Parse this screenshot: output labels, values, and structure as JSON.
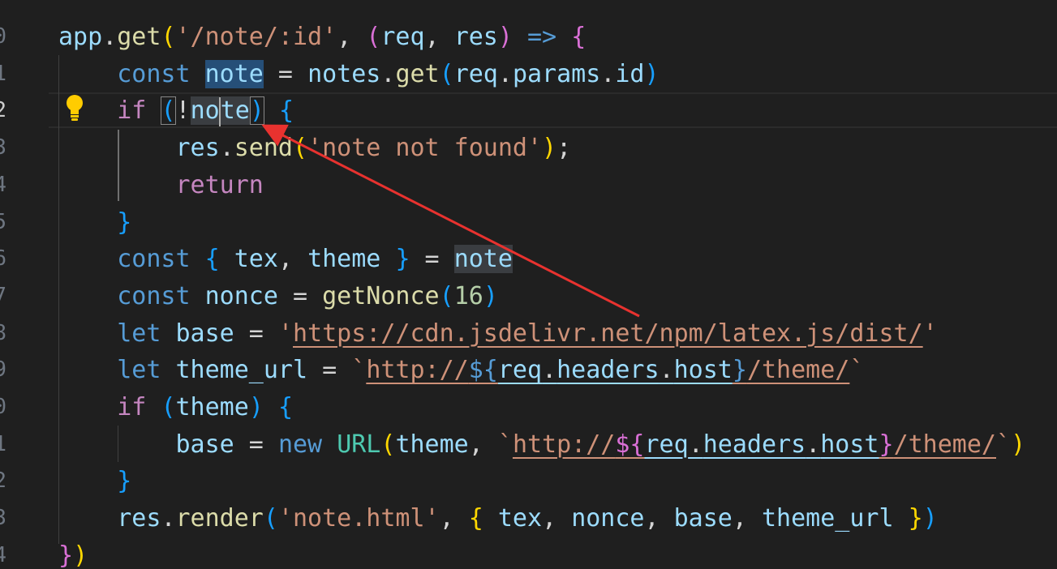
{
  "gutter": [
    "0",
    "1",
    "2",
    "3",
    "4",
    "5",
    "6",
    "7",
    "8",
    "9",
    "0",
    "1",
    "2",
    "3",
    "4"
  ],
  "colors": {
    "background": "#1f1f1f",
    "variable": "#9cdcfe",
    "function": "#dcdcaa",
    "keyword": "#569cd6",
    "control": "#c586c0",
    "string": "#ce9178",
    "number": "#b5cea8",
    "class": "#4ec9b0",
    "bracket_gold": "#ffd700",
    "bracket_orchid": "#da70d6",
    "bracket_blue": "#179fff",
    "arrow": "#e8322f"
  },
  "icons": {
    "lightbulb": "lightbulb-icon"
  },
  "lines": [
    [
      {
        "t": "app",
        "c": "v"
      },
      {
        "t": ".",
        "c": "pu"
      },
      {
        "t": "get",
        "c": "fn"
      },
      {
        "t": "(",
        "c": "b1"
      },
      {
        "t": "'/note/:id'",
        "c": "st"
      },
      {
        "t": ", ",
        "c": "pu"
      },
      {
        "t": "(",
        "c": "b2"
      },
      {
        "t": "req",
        "c": "v"
      },
      {
        "t": ", ",
        "c": "pu"
      },
      {
        "t": "res",
        "c": "v"
      },
      {
        "t": ")",
        "c": "b2"
      },
      {
        "t": " ",
        "c": "pu"
      },
      {
        "t": "=>",
        "c": "kw"
      },
      {
        "t": " ",
        "c": "pu"
      },
      {
        "t": "{",
        "c": "b2"
      }
    ],
    [
      {
        "t": "    ",
        "c": "pu"
      },
      {
        "t": "const",
        "c": "kw"
      },
      {
        "t": " ",
        "c": "pu"
      },
      {
        "t": "note",
        "c": "v hl"
      },
      {
        "t": " = ",
        "c": "pu"
      },
      {
        "t": "notes",
        "c": "v"
      },
      {
        "t": ".",
        "c": "pu"
      },
      {
        "t": "get",
        "c": "fn"
      },
      {
        "t": "(",
        "c": "b3"
      },
      {
        "t": "req",
        "c": "v"
      },
      {
        "t": ".",
        "c": "pu"
      },
      {
        "t": "params",
        "c": "v"
      },
      {
        "t": ".",
        "c": "pu"
      },
      {
        "t": "id",
        "c": "v"
      },
      {
        "t": ")",
        "c": "b3"
      }
    ],
    [
      {
        "t": "    ",
        "c": "pu"
      },
      {
        "t": "if",
        "c": "ct"
      },
      {
        "t": " ",
        "c": "pu"
      },
      {
        "t": "(",
        "c": "b3 bm"
      },
      {
        "t": "!",
        "c": "pu"
      },
      {
        "t": "no",
        "c": "v hl2"
      },
      {
        "t": "|",
        "c": "cursor"
      },
      {
        "t": "te",
        "c": "v hl2"
      },
      {
        "t": ")",
        "c": "b3 bm"
      },
      {
        "t": " ",
        "c": "pu"
      },
      {
        "t": "{",
        "c": "b3"
      }
    ],
    [
      {
        "t": "        ",
        "c": "pu"
      },
      {
        "t": "res",
        "c": "v"
      },
      {
        "t": ".",
        "c": "pu"
      },
      {
        "t": "send",
        "c": "fn"
      },
      {
        "t": "(",
        "c": "b1"
      },
      {
        "t": "'note not found'",
        "c": "st"
      },
      {
        "t": ")",
        "c": "b1"
      },
      {
        "t": ";",
        "c": "pu"
      }
    ],
    [
      {
        "t": "        ",
        "c": "pu"
      },
      {
        "t": "return",
        "c": "ct"
      }
    ],
    [
      {
        "t": "    ",
        "c": "pu"
      },
      {
        "t": "}",
        "c": "b3"
      }
    ],
    [
      {
        "t": "    ",
        "c": "pu"
      },
      {
        "t": "const",
        "c": "kw"
      },
      {
        "t": " ",
        "c": "pu"
      },
      {
        "t": "{",
        "c": "b3"
      },
      {
        "t": " ",
        "c": "pu"
      },
      {
        "t": "tex",
        "c": "v"
      },
      {
        "t": ", ",
        "c": "pu"
      },
      {
        "t": "theme",
        "c": "v"
      },
      {
        "t": " ",
        "c": "pu"
      },
      {
        "t": "}",
        "c": "b3"
      },
      {
        "t": " = ",
        "c": "pu"
      },
      {
        "t": "note",
        "c": "v hl2"
      }
    ],
    [
      {
        "t": "    ",
        "c": "pu"
      },
      {
        "t": "const",
        "c": "kw"
      },
      {
        "t": " ",
        "c": "pu"
      },
      {
        "t": "nonce",
        "c": "v"
      },
      {
        "t": " = ",
        "c": "pu"
      },
      {
        "t": "getNonce",
        "c": "fn"
      },
      {
        "t": "(",
        "c": "b3"
      },
      {
        "t": "16",
        "c": "nu"
      },
      {
        "t": ")",
        "c": "b3"
      }
    ],
    [
      {
        "t": "    ",
        "c": "pu"
      },
      {
        "t": "let",
        "c": "kw"
      },
      {
        "t": " ",
        "c": "pu"
      },
      {
        "t": "base",
        "c": "v"
      },
      {
        "t": " = ",
        "c": "pu"
      },
      {
        "t": "'",
        "c": "st"
      },
      {
        "t": "https://cdn.jsdelivr.net/npm/latex.js/dist/",
        "c": "st ul"
      },
      {
        "t": "'",
        "c": "st"
      }
    ],
    [
      {
        "t": "    ",
        "c": "pu"
      },
      {
        "t": "let",
        "c": "kw"
      },
      {
        "t": " ",
        "c": "pu"
      },
      {
        "t": "theme_url",
        "c": "v"
      },
      {
        "t": " = ",
        "c": "pu"
      },
      {
        "t": "`",
        "c": "st"
      },
      {
        "t": "http://",
        "c": "st ul"
      },
      {
        "t": "${",
        "c": "kw ul"
      },
      {
        "t": "req",
        "c": "v ulb"
      },
      {
        "t": ".",
        "c": "pu ulb"
      },
      {
        "t": "headers",
        "c": "v ulb"
      },
      {
        "t": ".",
        "c": "pu ulb"
      },
      {
        "t": "host",
        "c": "v ulb"
      },
      {
        "t": "}",
        "c": "kw ul"
      },
      {
        "t": "/theme/",
        "c": "st ul"
      },
      {
        "t": "`",
        "c": "st"
      }
    ],
    [
      {
        "t": "    ",
        "c": "pu"
      },
      {
        "t": "if",
        "c": "ct"
      },
      {
        "t": " ",
        "c": "pu"
      },
      {
        "t": "(",
        "c": "b3"
      },
      {
        "t": "theme",
        "c": "v"
      },
      {
        "t": ")",
        "c": "b3"
      },
      {
        "t": " ",
        "c": "pu"
      },
      {
        "t": "{",
        "c": "b3"
      }
    ],
    [
      {
        "t": "        ",
        "c": "pu"
      },
      {
        "t": "base",
        "c": "v"
      },
      {
        "t": " = ",
        "c": "pu"
      },
      {
        "t": "new",
        "c": "kw"
      },
      {
        "t": " ",
        "c": "pu"
      },
      {
        "t": "URL",
        "c": "cl"
      },
      {
        "t": "(",
        "c": "b1"
      },
      {
        "t": "theme",
        "c": "v"
      },
      {
        "t": ", ",
        "c": "pu"
      },
      {
        "t": "`",
        "c": "st"
      },
      {
        "t": "http://",
        "c": "st ul"
      },
      {
        "t": "${",
        "c": "b2 ul"
      },
      {
        "t": "req",
        "c": "v ulb"
      },
      {
        "t": ".",
        "c": "pu ulb"
      },
      {
        "t": "headers",
        "c": "v ulb"
      },
      {
        "t": ".",
        "c": "pu ulb"
      },
      {
        "t": "host",
        "c": "v ulb"
      },
      {
        "t": "}",
        "c": "b2 ul"
      },
      {
        "t": "/theme/",
        "c": "st ul"
      },
      {
        "t": "`",
        "c": "st"
      },
      {
        "t": ")",
        "c": "b1"
      }
    ],
    [
      {
        "t": "    ",
        "c": "pu"
      },
      {
        "t": "}",
        "c": "b3"
      }
    ],
    [
      {
        "t": "    ",
        "c": "pu"
      },
      {
        "t": "res",
        "c": "v"
      },
      {
        "t": ".",
        "c": "pu"
      },
      {
        "t": "render",
        "c": "fn"
      },
      {
        "t": "(",
        "c": "b3"
      },
      {
        "t": "'note.html'",
        "c": "st"
      },
      {
        "t": ", ",
        "c": "pu"
      },
      {
        "t": "{",
        "c": "b1"
      },
      {
        "t": " ",
        "c": "pu"
      },
      {
        "t": "tex",
        "c": "v"
      },
      {
        "t": ", ",
        "c": "pu"
      },
      {
        "t": "nonce",
        "c": "v"
      },
      {
        "t": ", ",
        "c": "pu"
      },
      {
        "t": "base",
        "c": "v"
      },
      {
        "t": ", ",
        "c": "pu"
      },
      {
        "t": "theme_url",
        "c": "v"
      },
      {
        "t": " ",
        "c": "pu"
      },
      {
        "t": "}",
        "c": "b1"
      },
      {
        "t": ")",
        "c": "b3"
      }
    ],
    [
      {
        "t": "}",
        "c": "b2"
      },
      {
        "t": ")",
        "c": "b1"
      }
    ]
  ]
}
